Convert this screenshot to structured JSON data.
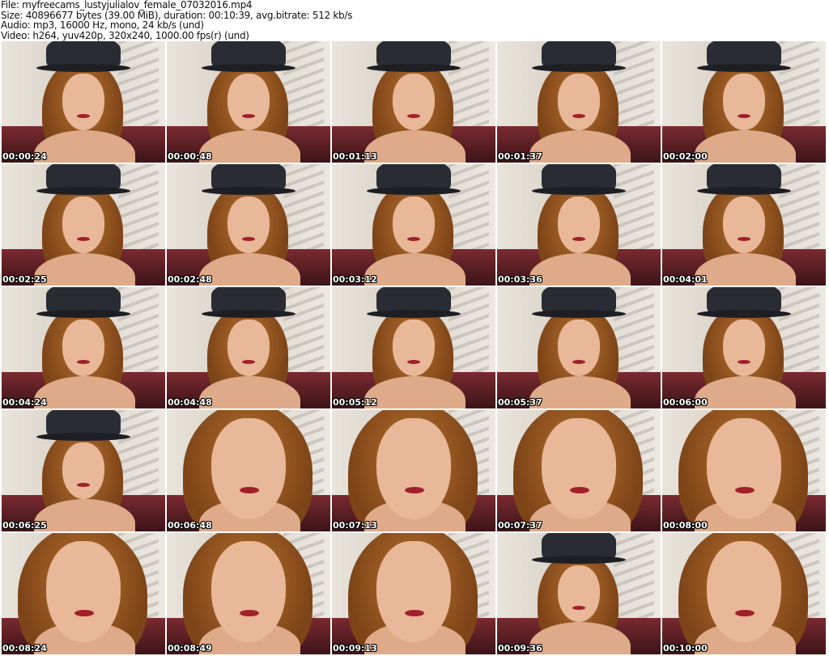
{
  "header": {
    "file": "File: myfreecams_lustyjulialov_female_07032016.mp4",
    "size": "Size: 40896677 bytes (39.00 MiB), duration: 00:10:39, avg.bitrate: 512 kb/s",
    "audio": "Audio: mp3, 16000 Hz, mono, 24 kb/s (und)",
    "video": "Video: h264, yuv420p, 320x240, 1000.00 fps(r) (und)"
  },
  "thumbnails": [
    {
      "time": "00:00:24",
      "hat": true
    },
    {
      "time": "00:00:48",
      "hat": true
    },
    {
      "time": "00:01:13",
      "hat": true
    },
    {
      "time": "00:01:37",
      "hat": true
    },
    {
      "time": "00:02:00",
      "hat": true
    },
    {
      "time": "00:02:25",
      "hat": true
    },
    {
      "time": "00:02:48",
      "hat": true
    },
    {
      "time": "00:03:12",
      "hat": true
    },
    {
      "time": "00:03:36",
      "hat": true
    },
    {
      "time": "00:04:01",
      "hat": true
    },
    {
      "time": "00:04:24",
      "hat": true
    },
    {
      "time": "00:04:48",
      "hat": true
    },
    {
      "time": "00:05:12",
      "hat": true
    },
    {
      "time": "00:05:37",
      "hat": true
    },
    {
      "time": "00:06:00",
      "hat": true
    },
    {
      "time": "00:06:25",
      "hat": true
    },
    {
      "time": "00:06:48",
      "hat": false
    },
    {
      "time": "00:07:13",
      "hat": false
    },
    {
      "time": "00:07:37",
      "hat": false
    },
    {
      "time": "00:08:00",
      "hat": false
    },
    {
      "time": "00:08:24",
      "hat": false
    },
    {
      "time": "00:08:49",
      "hat": false
    },
    {
      "time": "00:09:13",
      "hat": false
    },
    {
      "time": "00:09:36",
      "hat": true
    },
    {
      "time": "00:10:00",
      "hat": false
    }
  ]
}
